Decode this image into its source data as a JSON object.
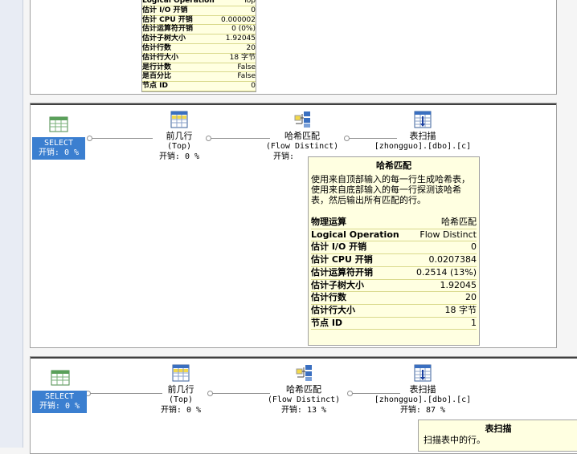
{
  "top_tooltip": {
    "rows": [
      {
        "k": "Logical Operation",
        "v": "Top"
      },
      {
        "k": "估计 I/O 开销",
        "v": "0"
      },
      {
        "k": "估计 CPU 开销",
        "v": "0.000002"
      },
      {
        "k": "估计运算符开销",
        "v": "0 (0%)"
      },
      {
        "k": "估计子树大小",
        "v": "1.92045"
      },
      {
        "k": "估计行数",
        "v": "20"
      },
      {
        "k": "估计行大小",
        "v": "18 字节"
      },
      {
        "k": "是行计数",
        "v": "False"
      },
      {
        "k": "是百分比",
        "v": "False"
      },
      {
        "k": "节点 ID",
        "v": "0"
      }
    ]
  },
  "plan1": {
    "select": {
      "line1": "SELECT",
      "line2": "开销: 0 %"
    },
    "top": {
      "title": "前几行",
      "sub": "(Top)",
      "cost": "开销: 0 %"
    },
    "hash": {
      "title": "哈希匹配",
      "sub": "(Flow Distinct)",
      "cost": "开销:"
    },
    "scan": {
      "title": "表扫描",
      "sub": "[zhongguo].[dbo].[c]"
    },
    "tooltip": {
      "title": "哈希匹配",
      "desc": "使用来自顶部输入的每一行生成哈希表，使用来自底部输入的每一行探测该哈希表，然后输出所有匹配的行。",
      "rows": [
        {
          "k": "物理运算",
          "v": "哈希匹配"
        },
        {
          "k": "Logical Operation",
          "v": "Flow Distinct"
        },
        {
          "k": "估计 I/O 开销",
          "v": "0"
        },
        {
          "k": "估计 CPU 开销",
          "v": "0.0207384"
        },
        {
          "k": "估计运算符开销",
          "v": "0.2514 (13%)"
        },
        {
          "k": "估计子树大小",
          "v": "1.92045"
        },
        {
          "k": "估计行数",
          "v": "20"
        },
        {
          "k": "估计行大小",
          "v": "18 字节"
        },
        {
          "k": "节点 ID",
          "v": "1"
        }
      ]
    }
  },
  "plan2": {
    "select": {
      "line1": "SELECT",
      "line2": "开销: 0 %"
    },
    "top": {
      "title": "前几行",
      "sub": "(Top)",
      "cost": "开销: 0 %"
    },
    "hash": {
      "title": "哈希匹配",
      "sub": "(Flow Distinct)",
      "cost": "开销: 13 %"
    },
    "scan": {
      "title": "表扫描",
      "sub": "[zhongguo].[dbo].[c]",
      "cost": "开销: 87 %"
    },
    "tooltip": {
      "title": "表扫描",
      "desc": "扫描表中的行。"
    }
  }
}
